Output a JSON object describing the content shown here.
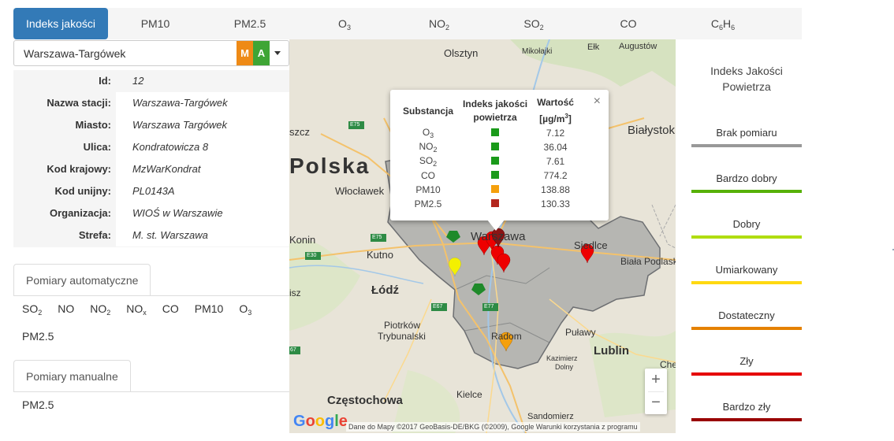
{
  "tabs": [
    "Indeks jakości",
    "PM10",
    "PM2.5",
    "O3",
    "NO2",
    "SO2",
    "CO",
    "C6H6"
  ],
  "tabs_sub": [
    [
      "",
      ""
    ],
    [
      "",
      ""
    ],
    [
      "",
      ""
    ],
    [
      "O",
      "3"
    ],
    [
      "NO",
      "2"
    ],
    [
      "SO",
      "2"
    ],
    [
      "",
      ""
    ],
    [
      "C",
      "6",
      "H",
      "6"
    ]
  ],
  "station": {
    "name": "Warszawa-Targówek",
    "badge_m": "M",
    "badge_a": "A"
  },
  "info": {
    "labels": {
      "id": "Id:",
      "name": "Nazwa stacji:",
      "city": "Miasto:",
      "street": "Ulica:",
      "national": "Kod krajowy:",
      "eu": "Kod unijny:",
      "org": "Organizacja:",
      "zone": "Strefa:"
    },
    "values": {
      "id": "12",
      "name": "Warszawa-Targówek",
      "city": "Warszawa Targówek",
      "street": "Kondratowicza 8",
      "national": "MzWarKondrat",
      "eu": "PL0143A",
      "org": "WIOŚ w Warszawie",
      "zone": "M. st. Warszawa"
    }
  },
  "auto": {
    "title": "Pomiary automatyczne",
    "items": [
      "SO2",
      "NO",
      "NO2",
      "NOx",
      "CO",
      "PM10",
      "O3",
      "PM2.5"
    ]
  },
  "manual": {
    "title": "Pomiary manualne",
    "items": [
      "PM2.5"
    ]
  },
  "popup": {
    "headers": {
      "substance": "Substancja",
      "index1": "Indeks jakości",
      "index2": "powietrza",
      "value1": "Wartość",
      "value2": "[µg/m3]"
    },
    "close": "×",
    "rows": [
      {
        "name": "O3",
        "color": "#1a9a1a",
        "value": "7.12"
      },
      {
        "name": "NO2",
        "color": "#1a9a1a",
        "value": "36.04"
      },
      {
        "name": "SO2",
        "color": "#1a9a1a",
        "value": "7.61"
      },
      {
        "name": "CO",
        "color": "#1a9a1a",
        "value": "774.2"
      },
      {
        "name": "PM10",
        "color": "#f5a00c",
        "value": "138.88"
      },
      {
        "name": "PM2.5",
        "color": "#b3261e",
        "value": "130.33"
      }
    ]
  },
  "map": {
    "labels": {
      "olsztyn": "Olsztyn",
      "mikolajki": "Mikołajki",
      "elk": "Ełk",
      "augustow": "Augustów",
      "polska": "Polska",
      "bialystok": "Białystok",
      "wloclawek": "Włocławek",
      "konin": "Konin",
      "kutno": "Kutno",
      "warszawa": "Warszawa",
      "siedlce": "Siedlce",
      "biala": "Biała Podlaska",
      "lodz": "Łódź",
      "piotrkow1": "Piotrków",
      "piotrkow2": "Trybunalski",
      "radom": "Radom",
      "pulawy": "Puławy",
      "lublin": "Lublin",
      "kazimierz1": "Kazimierz",
      "kazimierz2": "Dolny",
      "chelm": "Che",
      "czestochowa": "Częstochowa",
      "kielce": "Kielce",
      "sandomierz": "Sandomierz",
      "szcz": "szcz",
      "isz": "isz"
    },
    "roads": {
      "e75a": "E75",
      "e75b": "E75",
      "e30": "E30",
      "e67a": "E67",
      "e77": "E77",
      "e67b": "67"
    },
    "zoom_in": "+",
    "zoom_out": "−",
    "logo": "Google",
    "attribution": "Dane do Mapy ©2017 GeoBasis-DE/BKG (©2009), Google    Warunki korzystania z programu"
  },
  "legend": {
    "title1": "Indeks Jakości",
    "title2": "Powietrza",
    "items": [
      {
        "label": "Brak pomiaru",
        "color": "#999999"
      },
      {
        "label": "Bardzo dobry",
        "color": "#57b108"
      },
      {
        "label": "Dobry",
        "color": "#b0dd10"
      },
      {
        "label": "Umiarkowany",
        "color": "#ffd911"
      },
      {
        "label": "Dostateczny",
        "color": "#e58100"
      },
      {
        "label": "Zły",
        "color": "#e50000"
      },
      {
        "label": "Bardzo zły",
        "color": "#990000"
      }
    ]
  }
}
